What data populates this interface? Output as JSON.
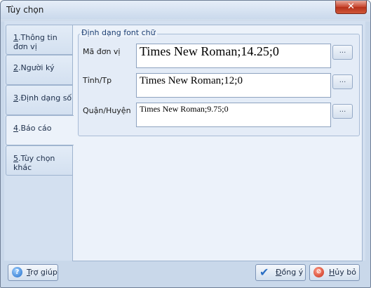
{
  "window": {
    "title": "Tùy chọn",
    "close_glyph": "✕"
  },
  "tabs": [
    {
      "num": "1",
      "label": ".Thông tin đơn vị"
    },
    {
      "num": "2",
      "label": ".Người ký"
    },
    {
      "num": "3",
      "label": ".Định dạng số"
    },
    {
      "num": "4",
      "label": ".Báo cáo"
    },
    {
      "num": "5",
      "label": ".Tùy chọn khác"
    }
  ],
  "group": {
    "title": "Định dạng font chữ"
  },
  "fields": [
    {
      "label": "Mã đơn vị",
      "value": "Times New Roman;14.25;0",
      "button": "..."
    },
    {
      "label": "Tỉnh/Tp",
      "value": "Times New Roman;12;0",
      "button": "..."
    },
    {
      "label": "Quận/Huyện",
      "value": "Times New Roman;9.75;0",
      "button": "..."
    }
  ],
  "buttons": {
    "help": {
      "underlined": "T",
      "rest": "rợ giúp",
      "icon": "help-icon"
    },
    "ok": {
      "underlined": "Đ",
      "rest": "ồng ý",
      "icon": "checkmark-icon"
    },
    "cancel": {
      "underlined": "H",
      "rest": "ủy bỏ",
      "icon": "cancel-icon"
    }
  },
  "colors": {
    "accent": "#1c3f73",
    "tab_bg": "#d3e0f0",
    "panel_bg": "#ecf2fa"
  }
}
